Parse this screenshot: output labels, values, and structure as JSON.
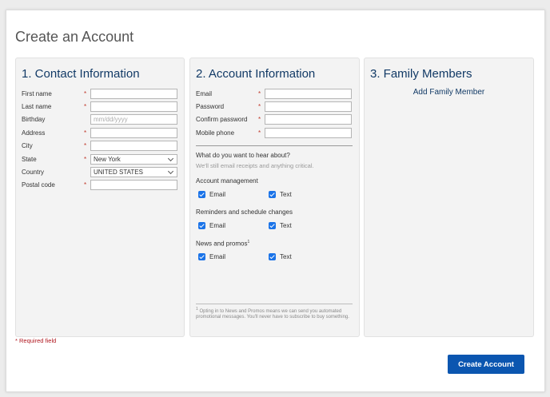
{
  "page_title": "Create an Account",
  "contact": {
    "heading": "1. Contact Information",
    "fields": [
      {
        "label": "First name",
        "required": "*",
        "value": "",
        "placeholder": ""
      },
      {
        "label": "Last name",
        "required": "*",
        "value": "",
        "placeholder": ""
      },
      {
        "label": "Birthday",
        "required": "",
        "value": "",
        "placeholder": "mm/dd/yyyy"
      },
      {
        "label": "Address",
        "required": "*",
        "value": "",
        "placeholder": ""
      },
      {
        "label": "City",
        "required": "*",
        "value": "",
        "placeholder": ""
      },
      {
        "label": "State",
        "required": "*",
        "value": "New York"
      },
      {
        "label": "Country",
        "required": "",
        "value": "UNITED STATES"
      },
      {
        "label": "Postal code",
        "required": "*",
        "value": "",
        "placeholder": ""
      }
    ]
  },
  "account": {
    "heading": "2. Account Information",
    "fields": [
      {
        "label": "Email",
        "required": "*"
      },
      {
        "label": "Password",
        "required": "*"
      },
      {
        "label": "Confirm password",
        "required": "*"
      },
      {
        "label": "Mobile phone",
        "required": "*"
      }
    ],
    "question": "What do you want to hear about?",
    "question_sub": "We'll still email receipts and anything critical.",
    "groups": [
      {
        "label": "Account management",
        "email_label": "Email",
        "text_label": "Text",
        "email_checked": true,
        "text_checked": true
      },
      {
        "label": "Reminders and schedule changes",
        "email_label": "Email",
        "text_label": "Text",
        "email_checked": true,
        "text_checked": true
      },
      {
        "label": "News and promos",
        "sup": "1",
        "email_label": "Email",
        "text_label": "Text",
        "email_checked": true,
        "text_checked": true
      }
    ],
    "footnote_mark": "1",
    "footnote": "Opting in to News and Promos means we can send you automated promotional messages. You'll never have to subscribe to buy something."
  },
  "family": {
    "heading": "3. Family Members",
    "add_link": "Add Family Member"
  },
  "required_note": "* Required field",
  "create_button": "Create Account",
  "colors": {
    "heading": "#123a66",
    "required": "#c0392b",
    "button": "#0b56b0",
    "checkbox": "#1a73e8"
  }
}
